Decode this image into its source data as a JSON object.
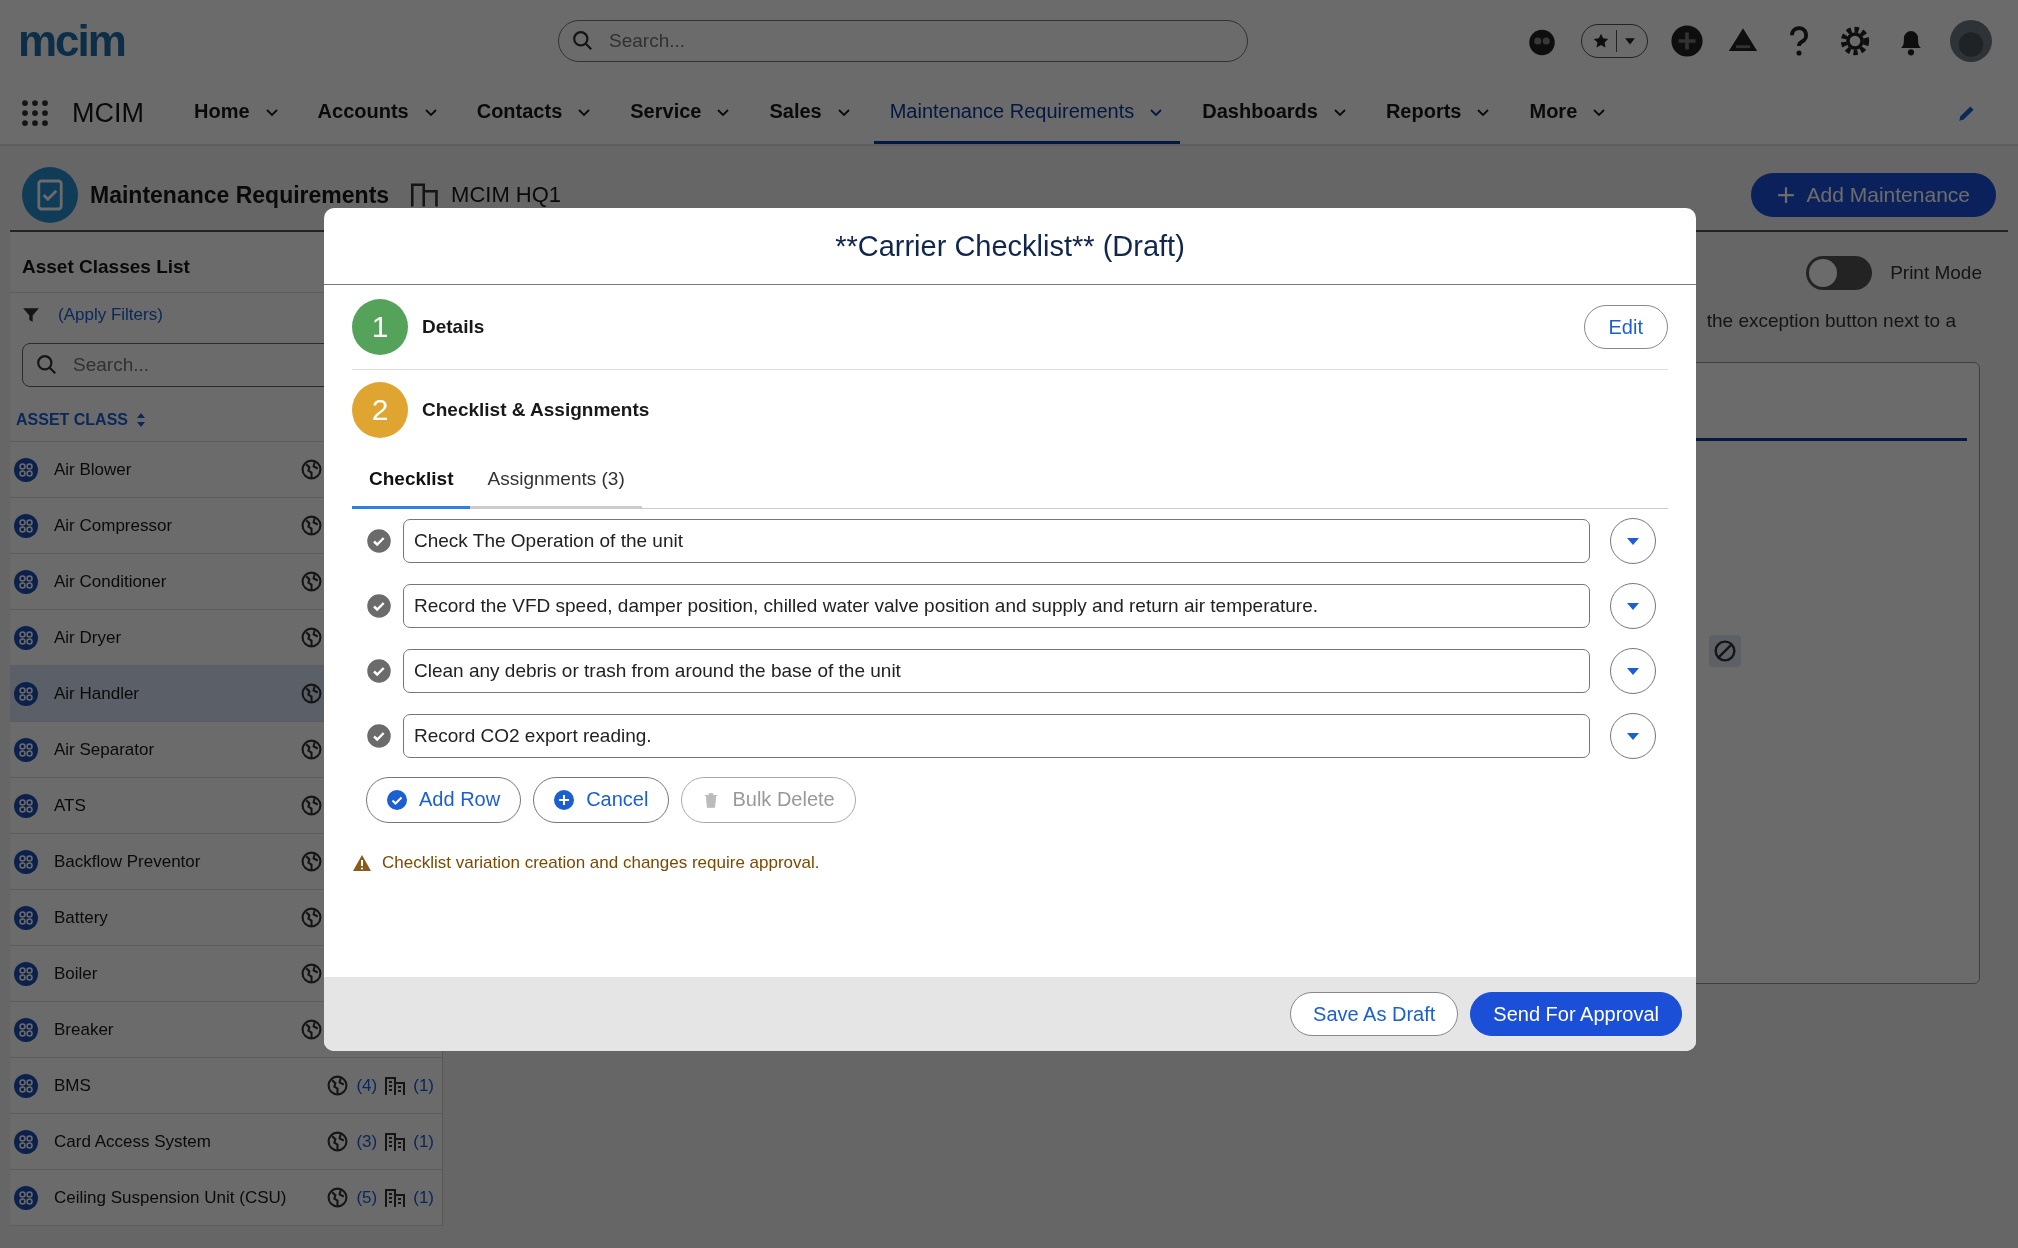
{
  "header": {
    "logo": "mcim",
    "search_placeholder": "Search..."
  },
  "nav": {
    "app_name": "MCIM",
    "items": [
      {
        "label": "Home",
        "selected": false
      },
      {
        "label": "Accounts",
        "selected": false
      },
      {
        "label": "Contacts",
        "selected": false
      },
      {
        "label": "Service",
        "selected": false
      },
      {
        "label": "Sales",
        "selected": false
      },
      {
        "label": "Maintenance Requirements",
        "selected": true
      },
      {
        "label": "Dashboards",
        "selected": false
      },
      {
        "label": "Reports",
        "selected": false
      },
      {
        "label": "More",
        "selected": false
      }
    ]
  },
  "page": {
    "title": "Maintenance Requirements",
    "location": "MCIM HQ1",
    "add_button": "Add Maintenance",
    "print_mode": {
      "label": "Print Mode",
      "on": false
    },
    "hint": "the exception button next to a"
  },
  "sidebar": {
    "title": "Asset Classes List",
    "filter_link": "(Apply Filters)",
    "search_placeholder": "Search...",
    "column": "ASSET CLASS",
    "items": [
      {
        "name": "Air Blower",
        "selected": false
      },
      {
        "name": "Air Compressor",
        "selected": false
      },
      {
        "name": "Air Conditioner",
        "selected": false
      },
      {
        "name": "Air Dryer",
        "selected": false
      },
      {
        "name": "Air Handler",
        "selected": true
      },
      {
        "name": "Air Separator",
        "selected": false
      },
      {
        "name": "ATS",
        "selected": false
      },
      {
        "name": "Backflow Preventor",
        "selected": false
      },
      {
        "name": "Battery",
        "selected": false
      },
      {
        "name": "Boiler",
        "selected": false
      },
      {
        "name": "Breaker",
        "selected": false
      },
      {
        "name": "BMS",
        "selected": false,
        "global_count": "(4)",
        "site_count": "(1)"
      },
      {
        "name": "Card Access System",
        "selected": false,
        "global_count": "(3)",
        "site_count": "(1)"
      },
      {
        "name": "Ceiling Suspension Unit (CSU)",
        "selected": false,
        "global_count": "(5)",
        "site_count": "(1)"
      }
    ]
  },
  "modal": {
    "title": "**Carrier Checklist** (Draft)",
    "steps": [
      {
        "number": "1",
        "label": "Details",
        "color": "#55a35a",
        "action": "Edit"
      },
      {
        "number": "2",
        "label": "Checklist & Assignments",
        "color": "#dfa530"
      }
    ],
    "tabs": [
      {
        "label": "Checklist",
        "selected": true
      },
      {
        "label": "Assignments (3)",
        "selected": false
      }
    ],
    "checklist": [
      {
        "text": "Check The Operation of the unit",
        "checked": true
      },
      {
        "text": "Record the VFD speed, damper position, chilled water valve position and supply and return air temperature.",
        "checked": true
      },
      {
        "text": "Clean any debris or trash from around the base of the unit",
        "checked": true
      },
      {
        "text": "Record CO2 export reading.",
        "checked": true
      }
    ],
    "buttons": [
      {
        "label": "Add Row",
        "kind": "check",
        "disabled": false
      },
      {
        "label": "Cancel",
        "kind": "plus",
        "disabled": false
      },
      {
        "label": "Bulk Delete",
        "kind": "trash",
        "disabled": true
      }
    ],
    "warning": "Checklist variation creation and changes require approval.",
    "footer_buttons": [
      {
        "label": "Save As Draft",
        "kind": "secondary"
      },
      {
        "label": "Send For Approval",
        "kind": "primary"
      }
    ]
  }
}
